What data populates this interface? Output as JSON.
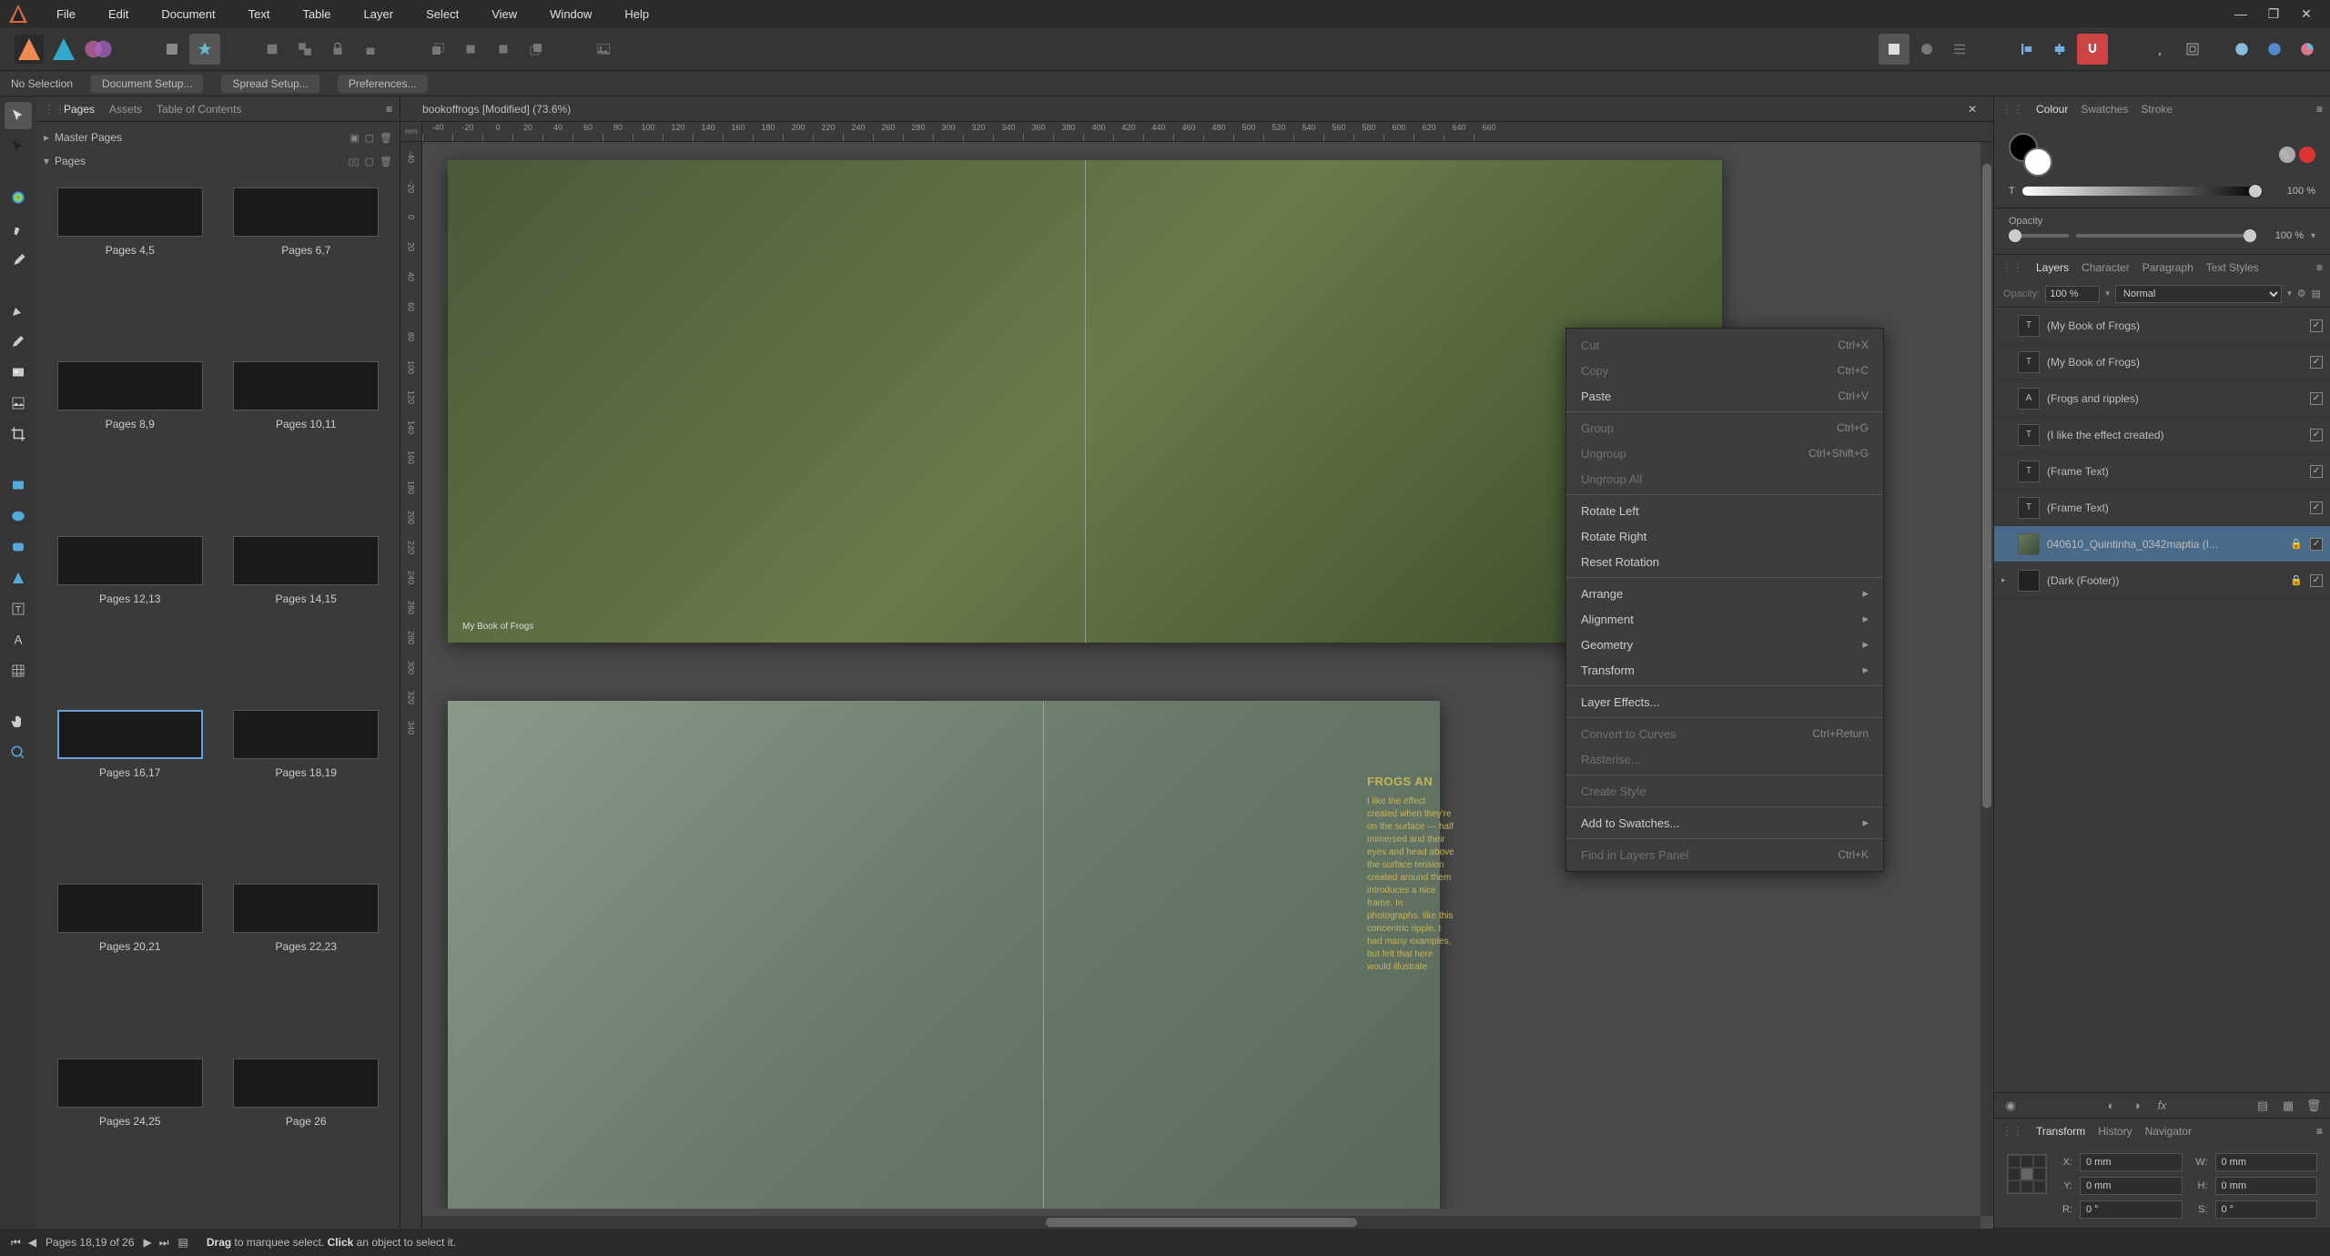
{
  "menu": {
    "items": [
      "File",
      "Edit",
      "Document",
      "Text",
      "Table",
      "Layer",
      "Select",
      "View",
      "Window",
      "Help"
    ]
  },
  "contextbar": {
    "no_selection": "No Selection",
    "btns": [
      "Document Setup...",
      "Spread Setup...",
      "Preferences..."
    ]
  },
  "document": {
    "title": "bookoffrogs [Modified] (73.6%)"
  },
  "left_panel": {
    "tabs": [
      "Pages",
      "Assets",
      "Table of Contents"
    ],
    "tree": {
      "master": "Master Pages",
      "pages": "Pages"
    },
    "thumbs": [
      {
        "cap": "Pages 4,5"
      },
      {
        "cap": "Pages 6,7"
      },
      {
        "cap": "Pages 8,9"
      },
      {
        "cap": "Pages 10,11"
      },
      {
        "cap": "Pages 12,13"
      },
      {
        "cap": "Pages 14,15"
      },
      {
        "cap": "Pages 16,17"
      },
      {
        "cap": "Pages 18,19"
      },
      {
        "cap": "Pages 20,21"
      },
      {
        "cap": "Pages 22,23"
      },
      {
        "cap": "Pages 24,25"
      },
      {
        "cap": "Page 26"
      }
    ]
  },
  "ruler_h": [
    "-40",
    "-20",
    "0",
    "20",
    "40",
    "60",
    "80",
    "100",
    "120",
    "140",
    "160",
    "180",
    "200",
    "220",
    "240",
    "260",
    "280",
    "300",
    "320",
    "340",
    "360",
    "380",
    "400",
    "420",
    "440",
    "460",
    "480",
    "500",
    "520",
    "540",
    "560",
    "580",
    "600",
    "620",
    "640",
    "660"
  ],
  "ruler_v": [
    "-40",
    "-20",
    "0",
    "20",
    "40",
    "60",
    "80",
    "100",
    "120",
    "140",
    "160",
    "180",
    "200",
    "220",
    "240",
    "260",
    "280",
    "300",
    "320",
    "340"
  ],
  "spread1": {
    "footer": "My Book of Frogs"
  },
  "spread2": {
    "heading": "FROGS AN",
    "body": "I like the effect created when they're on the surface — half immersed and their eyes and head above the surface tension created around them introduces a nice frame. In photographs, like this concentric ripple. I had many examples, but felt that here would illustrate"
  },
  "context_menu": [
    {
      "label": "Cut",
      "shortcut": "Ctrl+X",
      "enabled": false
    },
    {
      "label": "Copy",
      "shortcut": "Ctrl+C",
      "enabled": false
    },
    {
      "label": "Paste",
      "shortcut": "Ctrl+V",
      "enabled": true
    },
    {
      "sep": true
    },
    {
      "label": "Group",
      "shortcut": "Ctrl+G",
      "enabled": false
    },
    {
      "label": "Ungroup",
      "shortcut": "Ctrl+Shift+G",
      "enabled": false
    },
    {
      "label": "Ungroup All",
      "enabled": false
    },
    {
      "sep": true
    },
    {
      "label": "Rotate Left",
      "enabled": true
    },
    {
      "label": "Rotate Right",
      "enabled": true
    },
    {
      "label": "Reset Rotation",
      "enabled": true
    },
    {
      "sep": true
    },
    {
      "label": "Arrange",
      "sub": true,
      "enabled": true
    },
    {
      "label": "Alignment",
      "sub": true,
      "enabled": true
    },
    {
      "label": "Geometry",
      "sub": true,
      "enabled": true
    },
    {
      "label": "Transform",
      "sub": true,
      "enabled": true
    },
    {
      "sep": true
    },
    {
      "label": "Layer Effects...",
      "enabled": true
    },
    {
      "sep": true
    },
    {
      "label": "Convert to Curves",
      "shortcut": "Ctrl+Return",
      "enabled": false
    },
    {
      "label": "Rasterise...",
      "enabled": false
    },
    {
      "sep": true
    },
    {
      "label": "Create Style",
      "enabled": false
    },
    {
      "sep": true
    },
    {
      "label": "Add to Swatches...",
      "sub": true,
      "enabled": true
    },
    {
      "sep": true
    },
    {
      "label": "Find in Layers Panel",
      "shortcut": "Ctrl+K",
      "enabled": false
    }
  ],
  "right_panel": {
    "colour_tabs": [
      "Colour",
      "Swatches",
      "Stroke"
    ],
    "tint_label": "T",
    "tint_value": "100 %",
    "opacity_label": "Opacity",
    "opacity_value": "100 %",
    "layers_tabs": [
      "Layers",
      "Character",
      "Paragraph",
      "Text Styles"
    ],
    "layers_opacity_label": "Opacity:",
    "layers_opacity_value": "100 %",
    "blend_mode": "Normal",
    "layers": [
      {
        "name": "(My Book of Frogs)",
        "type": "T",
        "checked": true
      },
      {
        "name": "(My Book of Frogs)",
        "type": "T",
        "checked": true
      },
      {
        "name": "(Frogs and ripples)",
        "type": "A",
        "checked": true
      },
      {
        "name": "(I like the effect created)",
        "type": "T",
        "checked": true
      },
      {
        "name": "(Frame Text)",
        "type": "T",
        "checked": true
      },
      {
        "name": "(Frame Text)",
        "type": "T",
        "checked": true
      },
      {
        "name": "040610_Quintinha_0342maptia (I...",
        "type": "img",
        "checked": true,
        "selected": true,
        "locked": true
      },
      {
        "name": "(Dark (Footer))",
        "type": "rect",
        "checked": true,
        "locked": true,
        "expandable": true
      }
    ],
    "transform_tabs": [
      "Transform",
      "History",
      "Navigator"
    ],
    "transform": {
      "x": "0 mm",
      "y": "0 mm",
      "w": "0 mm",
      "h": "0 mm",
      "r": "0 °",
      "s": "0 °"
    }
  },
  "statusbar": {
    "pager": "Pages 18,19 of 26",
    "hint_drag": "Drag",
    "hint_drag_t": "to marquee select.",
    "hint_click": "Click",
    "hint_click_t": "an object to select it."
  }
}
